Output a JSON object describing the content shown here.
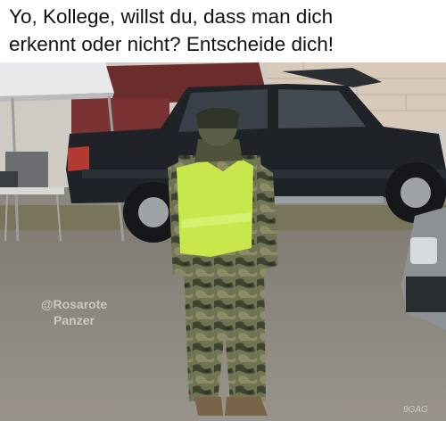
{
  "meme": {
    "caption": {
      "line1": "Yo, Kollege, willst du, dass man dich",
      "line2": "erkennt oder nicht? Entscheide dich!"
    },
    "watermark": {
      "line1": "@Rosarote",
      "line2": "Panzer"
    },
    "corner_mark": "9GAG"
  },
  "colors": {
    "caption_background": "#ffffff",
    "caption_text": "#111111",
    "safety_vest": "#c9e64a",
    "camouflage": "#5d6448",
    "truck": "#1f2328",
    "gravel": "#8c877f"
  },
  "photo": {
    "description_icons": [
      "person-in-camouflage",
      "black-pickup-truck",
      "white-canopy-tent",
      "gravel-lot"
    ]
  }
}
